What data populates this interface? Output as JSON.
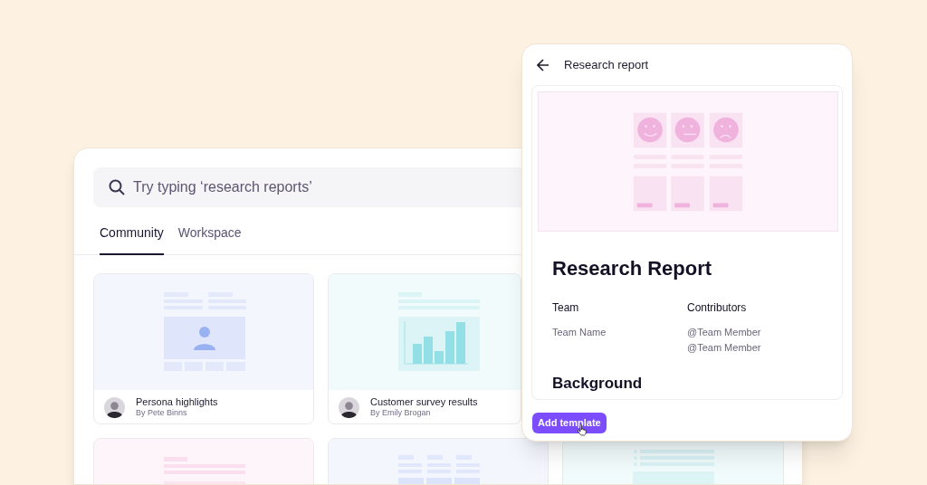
{
  "search": {
    "placeholder": "Try typing ‘research reports’"
  },
  "tabs": [
    {
      "label": "Community",
      "selected": true
    },
    {
      "label": "Workspace",
      "selected": false
    }
  ],
  "card_rows": [
    [
      {
        "kind": "persona",
        "title": "Persona highlights",
        "author": "By Pete Binns"
      },
      {
        "kind": "chart",
        "title": "Customer survey results",
        "author": "By Emily Brogan"
      }
    ],
    [
      {
        "kind": "document"
      },
      {
        "kind": "table"
      },
      {
        "kind": "checklist"
      }
    ]
  ],
  "detail": {
    "title": "Research report",
    "kind": "sentiment",
    "heading": "Research Report",
    "fields": [
      {
        "label": "Team",
        "values": [
          "Team Name"
        ]
      },
      {
        "label": "Contributors",
        "values": [
          "@Team Member",
          "@Team Member"
        ]
      }
    ],
    "section": "Background",
    "button": "Add template"
  }
}
